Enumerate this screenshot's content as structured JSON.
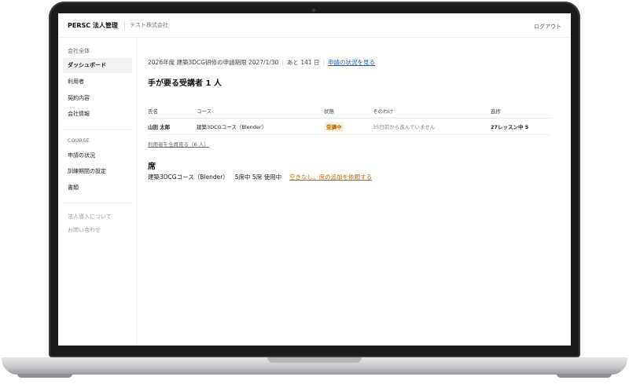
{
  "header": {
    "brand": "PERSC 法人管理",
    "company": "テスト株式会社",
    "logout": "ログアウト"
  },
  "sidebar": {
    "items": [
      {
        "label": "会社全体"
      },
      {
        "label": "ダッシュボード"
      },
      {
        "label": "利用者"
      },
      {
        "label": "契約内容"
      },
      {
        "label": "会社情報"
      }
    ],
    "course_heading": "COURSE",
    "course_items": [
      {
        "label": "申請の状況"
      },
      {
        "label": "訓練期間の設定"
      },
      {
        "label": "書類"
      }
    ],
    "footer_links": [
      {
        "label": "法人導入について"
      },
      {
        "label": "お問い合わせ"
      }
    ]
  },
  "main": {
    "deadline_text": "2026年度 建築3DCG研修の申請期限 2027/1/30",
    "remaining_text": "あと 141 日",
    "status_link": "申請の状況を見る",
    "attention_title": "手が要る受講者 1 人",
    "table": {
      "headers": [
        "氏名",
        "コース",
        "状態",
        "そのわけ",
        "進捗"
      ],
      "rows": [
        {
          "name": "山田 太郎",
          "course": "建築3DCGコース（Blender）",
          "status": "受講中",
          "reason": "35日前から進んでいません",
          "progress": "27レッスン中 5"
        }
      ]
    },
    "see_all_link": "利用者を全員見る（6 人）",
    "seats_title": "席",
    "seats_course": "建築3DCGコース（Blender）",
    "seats_usage": "5席中 5席 使用中",
    "seats_request_link": "空きなし。席の追加を依頼する"
  },
  "colors": {
    "accent_link": "#1a5fb4",
    "status_badge_text": "#b7640a",
    "status_badge_bg": "#fdf1de",
    "warning_link": "#c56a10"
  }
}
